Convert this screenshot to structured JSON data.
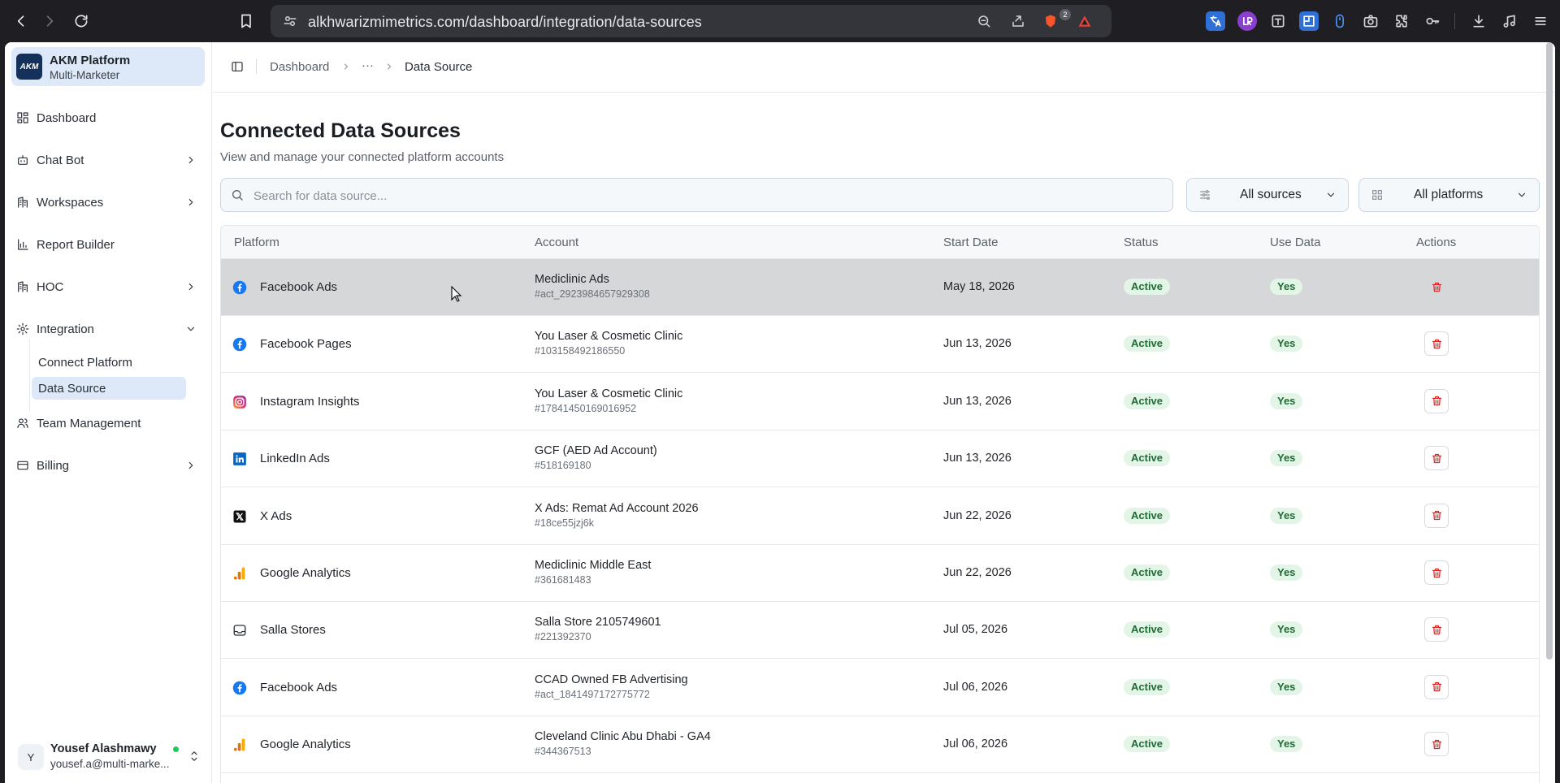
{
  "browser": {
    "url": "alkhwarizmimetrics.com/dashboard/integration/data-sources",
    "brave_badge": "2"
  },
  "sidebar": {
    "brand_title": "AKM Platform",
    "brand_subtitle": "Multi-Marketer",
    "brand_logo_text": "AKM",
    "items": [
      {
        "label": "Dashboard",
        "icon": "grid-icon"
      },
      {
        "label": "Chat Bot",
        "icon": "bot-icon"
      },
      {
        "label": "Workspaces",
        "icon": "building-icon"
      },
      {
        "label": "Report Builder",
        "icon": "bar-chart-icon"
      },
      {
        "label": "HOC",
        "icon": "building-icon"
      },
      {
        "label": "Integration",
        "icon": "gear-icon"
      },
      {
        "label": "Team Management",
        "icon": "users-icon"
      },
      {
        "label": "Billing",
        "icon": "wallet-icon"
      }
    ],
    "integration_sub": [
      {
        "label": "Connect Platform"
      },
      {
        "label": "Data Source"
      }
    ],
    "user": {
      "initial": "Y",
      "name": "Yousef Alashmawy",
      "email": "yousef.a@multi-marke..."
    }
  },
  "breadcrumb": {
    "first": "Dashboard",
    "ellipsis": "···",
    "current": "Data Source"
  },
  "main": {
    "title": "Connected Data Sources",
    "subtitle": "View and manage your connected platform accounts",
    "search_placeholder": "Search for data source...",
    "filter_sources": "All sources",
    "filter_platforms": "All platforms"
  },
  "table": {
    "headers": {
      "platform": "Platform",
      "account": "Account",
      "start_date": "Start Date",
      "status": "Status",
      "use_data": "Use Data",
      "actions": "Actions"
    },
    "rows": [
      {
        "platform": "Facebook Ads",
        "icon": "facebook-icon",
        "account": "Mediclinic Ads",
        "id": "#act_2923984657929308",
        "date": "May 18, 2026",
        "status": "Active",
        "use": "Yes"
      },
      {
        "platform": "Facebook Pages",
        "icon": "facebook-icon",
        "account": "You Laser & Cosmetic Clinic",
        "id": "#103158492186550",
        "date": "Jun 13, 2026",
        "status": "Active",
        "use": "Yes"
      },
      {
        "platform": "Instagram Insights",
        "icon": "instagram-icon",
        "account": "You Laser & Cosmetic Clinic",
        "id": "#17841450169016952",
        "date": "Jun 13, 2026",
        "status": "Active",
        "use": "Yes"
      },
      {
        "platform": "LinkedIn Ads",
        "icon": "linkedin-icon",
        "account": "GCF (AED Ad Account)",
        "id": "#518169180",
        "date": "Jun 13, 2026",
        "status": "Active",
        "use": "Yes"
      },
      {
        "platform": "X Ads",
        "icon": "x-icon",
        "account": "X Ads: Remat Ad Account 2026",
        "id": "#18ce55jzj6k",
        "date": "Jun 22, 2026",
        "status": "Active",
        "use": "Yes"
      },
      {
        "platform": "Google Analytics",
        "icon": "google-analytics-icon",
        "account": "Mediclinic Middle East",
        "id": "#361681483",
        "date": "Jun 22, 2026",
        "status": "Active",
        "use": "Yes"
      },
      {
        "platform": "Salla Stores",
        "icon": "inbox-icon",
        "account": "Salla Store 2105749601",
        "id": "#221392370",
        "date": "Jul 05, 2026",
        "status": "Active",
        "use": "Yes"
      },
      {
        "platform": "Facebook Ads",
        "icon": "facebook-icon",
        "account": "CCAD Owned FB Advertising",
        "id": "#act_1841497172775772",
        "date": "Jul 06, 2026",
        "status": "Active",
        "use": "Yes"
      },
      {
        "platform": "Google Analytics",
        "icon": "google-analytics-icon",
        "account": "Cleveland Clinic Abu Dhabi - GA4",
        "id": "#344367513",
        "date": "Jul 06, 2026",
        "status": "Active",
        "use": "Yes"
      }
    ]
  },
  "colors": {
    "accent": "#dde9f8",
    "facebook": "#1877f2",
    "linkedin": "#0a66c2",
    "ga_orange": "#f9ab00",
    "danger": "#dc2626",
    "badge_bg": "#e2f5e6"
  }
}
